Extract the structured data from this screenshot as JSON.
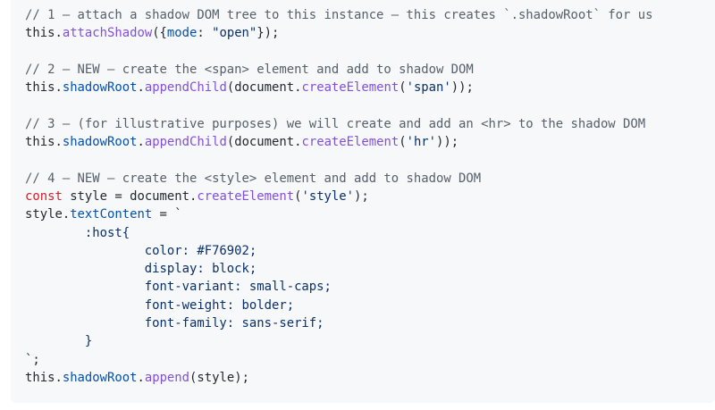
{
  "code_block": {
    "language": "javascript",
    "colors": {
      "background": "#f6f8fa",
      "plain": "#24292f",
      "comment": "#57606a",
      "keyword": "#cf222e",
      "string": "#0a3069",
      "function": "#8250df",
      "property": "#0550ae"
    },
    "lines": [
      [
        {
          "t": "comment",
          "v": "// 1 – attach a shadow DOM tree to this instance – this creates `.shadowRoot` for us"
        }
      ],
      [
        {
          "t": "plain",
          "v": "this."
        },
        {
          "t": "func",
          "v": "attachShadow"
        },
        {
          "t": "plain",
          "v": "({"
        },
        {
          "t": "prop",
          "v": "mode"
        },
        {
          "t": "plain",
          "v": ": "
        },
        {
          "t": "string",
          "v": "\"open\""
        },
        {
          "t": "plain",
          "v": "});"
        }
      ],
      [],
      [
        {
          "t": "comment",
          "v": "// 2 – NEW – create the <span> element and add to shadow DOM"
        }
      ],
      [
        {
          "t": "plain",
          "v": "this."
        },
        {
          "t": "prop",
          "v": "shadowRoot"
        },
        {
          "t": "plain",
          "v": "."
        },
        {
          "t": "func",
          "v": "appendChild"
        },
        {
          "t": "plain",
          "v": "(document."
        },
        {
          "t": "func",
          "v": "createElement"
        },
        {
          "t": "plain",
          "v": "("
        },
        {
          "t": "string",
          "v": "'span'"
        },
        {
          "t": "plain",
          "v": "));"
        }
      ],
      [],
      [
        {
          "t": "comment",
          "v": "// 3 – (for illustrative purposes) we will create and add an <hr> to the shadow DOM"
        }
      ],
      [
        {
          "t": "plain",
          "v": "this."
        },
        {
          "t": "prop",
          "v": "shadowRoot"
        },
        {
          "t": "plain",
          "v": "."
        },
        {
          "t": "func",
          "v": "appendChild"
        },
        {
          "t": "plain",
          "v": "(document."
        },
        {
          "t": "func",
          "v": "createElement"
        },
        {
          "t": "plain",
          "v": "("
        },
        {
          "t": "string",
          "v": "'hr'"
        },
        {
          "t": "plain",
          "v": "));"
        }
      ],
      [],
      [
        {
          "t": "comment",
          "v": "// 4 – NEW – create the <style> element and add to shadow DOM"
        }
      ],
      [
        {
          "t": "keyword",
          "v": "const"
        },
        {
          "t": "plain",
          "v": " style = document."
        },
        {
          "t": "func",
          "v": "createElement"
        },
        {
          "t": "plain",
          "v": "("
        },
        {
          "t": "string",
          "v": "'style'"
        },
        {
          "t": "plain",
          "v": ");"
        }
      ],
      [
        {
          "t": "plain",
          "v": "style."
        },
        {
          "t": "prop",
          "v": "textContent"
        },
        {
          "t": "plain",
          "v": " = "
        },
        {
          "t": "string",
          "v": "`"
        }
      ],
      [
        {
          "t": "string",
          "v": "        :host{"
        }
      ],
      [
        {
          "t": "string",
          "v": "                color: #F76902;"
        }
      ],
      [
        {
          "t": "string",
          "v": "                display: block;"
        }
      ],
      [
        {
          "t": "string",
          "v": "                font-variant: small-caps;"
        }
      ],
      [
        {
          "t": "string",
          "v": "                font-weight: bolder;"
        }
      ],
      [
        {
          "t": "string",
          "v": "                font-family: sans-serif;"
        }
      ],
      [
        {
          "t": "string",
          "v": "        }"
        }
      ],
      [
        {
          "t": "string",
          "v": "`"
        },
        {
          "t": "plain",
          "v": ";"
        }
      ],
      [
        {
          "t": "plain",
          "v": "this."
        },
        {
          "t": "prop",
          "v": "shadowRoot"
        },
        {
          "t": "plain",
          "v": "."
        },
        {
          "t": "func",
          "v": "append"
        },
        {
          "t": "plain",
          "v": "(style);"
        }
      ]
    ]
  }
}
